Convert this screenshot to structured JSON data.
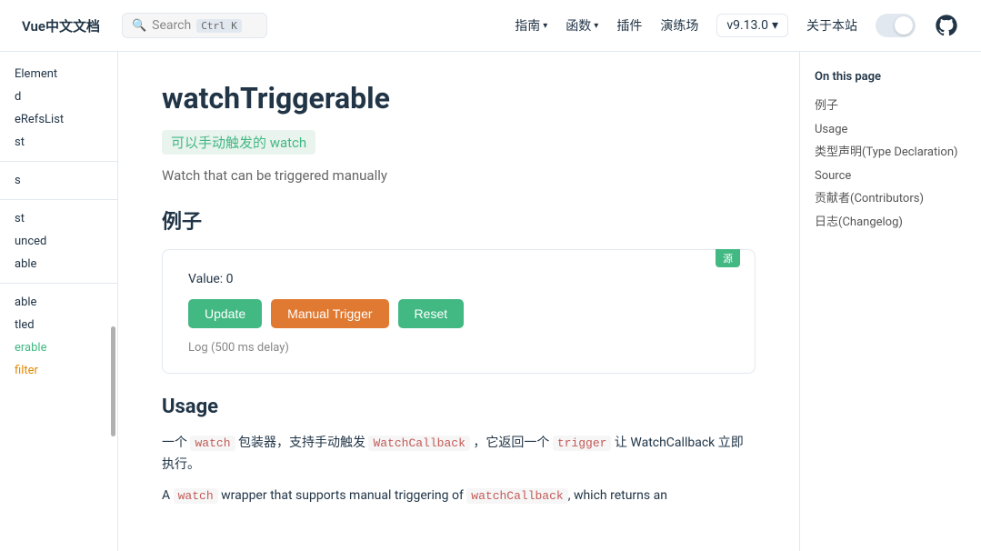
{
  "header": {
    "logo": "Vue中文文档",
    "search_label": "Search",
    "search_kbd": "Ctrl K",
    "nav_items": [
      {
        "label": "指南",
        "has_dropdown": true
      },
      {
        "label": "函数",
        "has_dropdown": true
      },
      {
        "label": "插件",
        "has_badge": false
      },
      {
        "label": "演练场"
      },
      {
        "label": "v9.13.0",
        "has_dropdown": true
      },
      {
        "label": "关于本站"
      }
    ],
    "plugin_label": "插件",
    "version": "v9.13.0"
  },
  "sidebar": {
    "items": [
      {
        "label": "Element",
        "active": false
      },
      {
        "label": "d",
        "active": false
      },
      {
        "label": "eRefsList",
        "active": false
      },
      {
        "label": "st",
        "active": false
      },
      {
        "label": "s",
        "active": false
      },
      {
        "label": "st",
        "active": false
      },
      {
        "label": "unced",
        "active": false
      },
      {
        "label": "able",
        "active": false
      },
      {
        "label": "able",
        "active": false
      },
      {
        "label": "tled",
        "active": false
      },
      {
        "label": "erable",
        "active": true,
        "orange": false
      },
      {
        "label": "filter",
        "active": false
      }
    ]
  },
  "page": {
    "title": "watchTriggerable",
    "subtitle_badge": "可以手动触发的 watch",
    "subtitle_text": "Watch that can be triggered manually",
    "section_example": "例子",
    "demo": {
      "tag": "源",
      "value_label": "Value: 0",
      "btn_update": "Update",
      "btn_manual": "Manual Trigger",
      "btn_reset": "Reset",
      "log_text": "Log (500 ms delay)"
    },
    "section_usage": "Usage",
    "usage_para1_pre": "一个 ",
    "usage_code1": "watch",
    "usage_para1_mid": " 包装器，支持手动触发 ",
    "usage_code2": "WatchCallback",
    "usage_para1_mid2": " ，它返回一个 ",
    "usage_code3": "trigger",
    "usage_para1_end": " 让 WatchCallback 立即执行。",
    "usage_para2": "A watch wrapper that supports manual triggering of watchCallback, which returns an"
  },
  "toc": {
    "title": "On this page",
    "items": [
      {
        "label": "例子",
        "active": false
      },
      {
        "label": "Usage",
        "active": false
      },
      {
        "label": "类型声明(Type Declaration)",
        "active": false
      },
      {
        "label": "Source",
        "active": false
      },
      {
        "label": "贡献者(Contributors)",
        "active": false
      },
      {
        "label": "日志(Changelog)",
        "active": false
      }
    ]
  }
}
